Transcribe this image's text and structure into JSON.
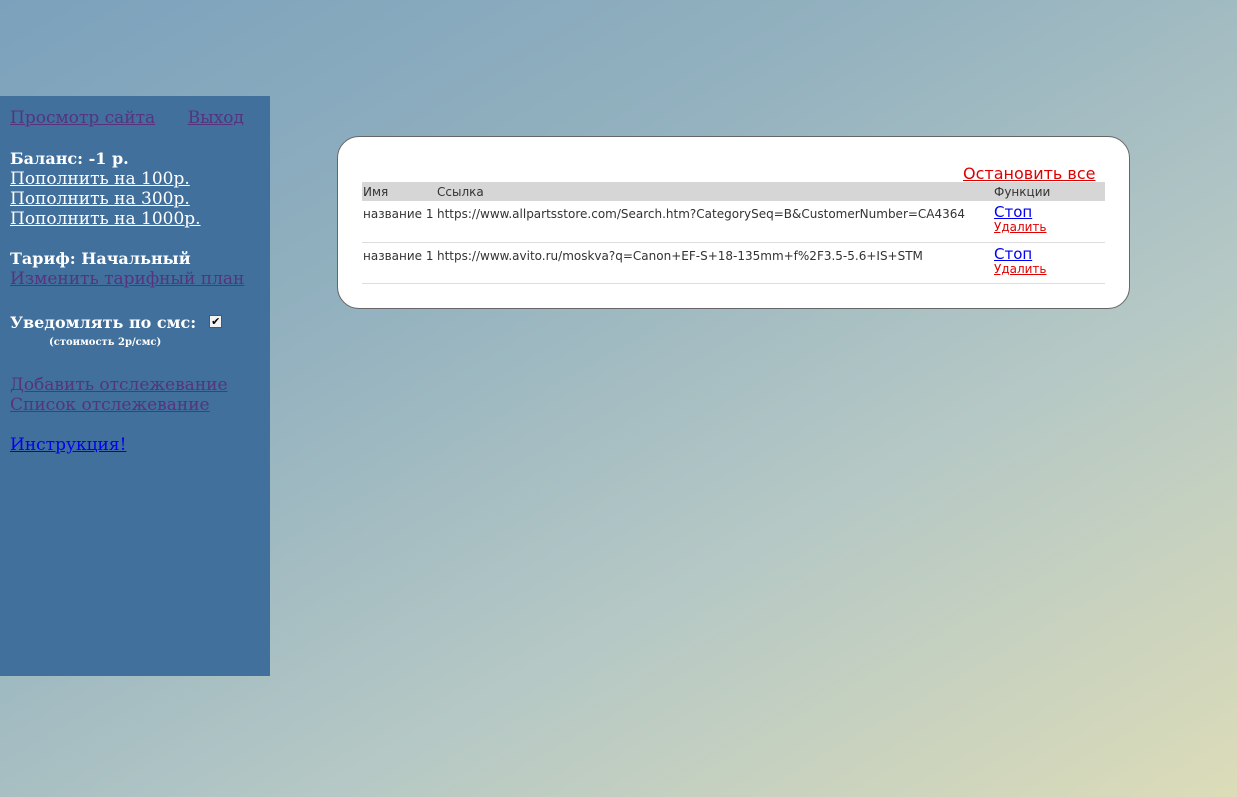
{
  "sidebar": {
    "view_site": "Просмотр сайта",
    "logout": "Выход",
    "balance": "Баланс: -1 р.",
    "topup": [
      "Пополнить на 100р.",
      "Пополнить на 300р.",
      "Пополнить на 1000р."
    ],
    "tariff": "Тариф: Начальный",
    "change_tariff": "Изменить тарифный план",
    "sms_label": "Уведомлять по смс:",
    "sms_checked": true,
    "sms_cost": "(стоимость 2р/смс)",
    "add_tracking": "Добавить отслежевание",
    "list_tracking": "Список отслежевание",
    "instructions": "Инструкция!"
  },
  "panel": {
    "stop_all": "Остановить все",
    "headers": {
      "name": "Имя",
      "link": "Ссылка",
      "functions": "Функции"
    },
    "rows": [
      {
        "name": "название 1",
        "link": "https://www.allpartsstore.com/Search.htm?CategorySeq=B&CustomerNumber=CA4364",
        "stop": "Стоп",
        "delete": "Удалить"
      },
      {
        "name": "название 1",
        "link": "https://www.avito.ru/moskva?q=Canon+EF-S+18-135mm+f%2F3.5-5.6+IS+STM",
        "stop": "Стоп",
        "delete": "Удалить"
      }
    ]
  },
  "icons": {
    "checkbox": "check-mark-icon"
  },
  "colors": {
    "sidebar_bg": "#41709c",
    "stop_all": "#e00000",
    "link_blue": "#0000ee",
    "visited": "#55337d"
  }
}
